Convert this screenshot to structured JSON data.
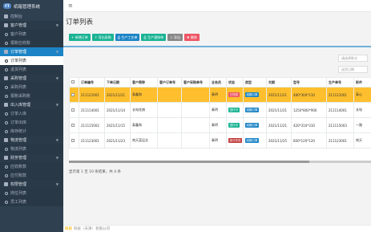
{
  "brand": {
    "badge": "FT",
    "name": "纸箱管理系统"
  },
  "sidebar": {
    "items": [
      {
        "type": "item",
        "label": "控制台"
      },
      {
        "type": "group",
        "label": "客户管理"
      },
      {
        "type": "sub",
        "label": "客户列表"
      },
      {
        "type": "sub",
        "label": "报账应收账"
      },
      {
        "type": "group-active",
        "label": "订单管理"
      },
      {
        "type": "sub-active",
        "label": "订单列表"
      },
      {
        "type": "sub",
        "label": "退货列表"
      },
      {
        "type": "group",
        "label": "采购管理"
      },
      {
        "type": "sub",
        "label": "采购列表"
      },
      {
        "type": "sub",
        "label": "报账采购账"
      },
      {
        "type": "group",
        "label": "出入库管理"
      },
      {
        "type": "sub",
        "label": "订单入库"
      },
      {
        "type": "sub",
        "label": "订单出库"
      },
      {
        "type": "sub",
        "label": "库存统计"
      },
      {
        "type": "group",
        "label": "物流管理"
      },
      {
        "type": "sub",
        "label": "物流列表"
      },
      {
        "type": "group",
        "label": "财务管理"
      },
      {
        "type": "sub",
        "label": "应收账款"
      },
      {
        "type": "sub",
        "label": "应付账款"
      },
      {
        "type": "group",
        "label": "权限管理"
      },
      {
        "type": "sub",
        "label": "岗位列表"
      },
      {
        "type": "sub",
        "label": "员工列表"
      }
    ]
  },
  "page": {
    "title": "订单列表"
  },
  "toolbar": [
    {
      "label": "新增订单",
      "glyph": "+",
      "color": "green"
    },
    {
      "label": "导出采购",
      "glyph": "⇪",
      "color": "green"
    },
    {
      "label": "生产工艺单",
      "glyph": "⎙",
      "color": "blue"
    },
    {
      "label": "生产通知单",
      "glyph": "⎙",
      "color": "green"
    },
    {
      "label": "导出",
      "glyph": "⇩",
      "color": "gray"
    },
    {
      "label": "删除",
      "glyph": "✖",
      "color": "red"
    }
  ],
  "search": {
    "placeholder1": "请选择款式",
    "placeholder2": "送货日期"
  },
  "table": {
    "columns": [
      "",
      "订单编号",
      "下单日期",
      "客户简称",
      "客户订单号",
      "客户采购单号",
      "业务员",
      "状态",
      "类型",
      "交期",
      "型号",
      "生产单号",
      "彩件"
    ],
    "rows": [
      {
        "selected": true,
        "cells": [
          "211121001",
          "2021/11/21",
          "泰鑫和",
          "",
          "",
          "秦明",
          "已完成",
          "纸箱订单",
          "2021/11/21",
          "480*300*210",
          "211121001",
          "泰心"
        ],
        "status_color": "red",
        "type_color": "blue"
      },
      {
        "selected": false,
        "cells": [
          "211114001",
          "2021/11/14",
          "长电花旗",
          "",
          "",
          "秦明",
          "进行中",
          "纸箱订单",
          "2021/11/21",
          "1250*800*900",
          "211114001",
          "长电"
        ],
        "status_color": "green",
        "type_color": "blue"
      },
      {
        "selected": false,
        "cells": [
          "211115002",
          "2021/11/15",
          "泰鑫和",
          "",
          "",
          "秦明",
          "进行中",
          "纸箱订单",
          "2021/11/21",
          "420*310*310",
          "211115003",
          "一路"
        ],
        "status_color": "green",
        "type_color": "blue"
      },
      {
        "selected": false,
        "cells": [
          "211123001",
          "2021/11/23",
          "南天蓝运业",
          "",
          "",
          "秦明",
          "部分完成",
          "纸箱订单",
          "2021/11/25",
          "600*120*120",
          "211123001",
          "南天"
        ],
        "status_color": "darkred",
        "type_color": "blue"
      }
    ]
  },
  "pager": {
    "info": "显示第 1 至 10 条结果，共 4 条"
  },
  "footer": {
    "brand": "科技",
    "text": "科技（天津）有限公司"
  }
}
